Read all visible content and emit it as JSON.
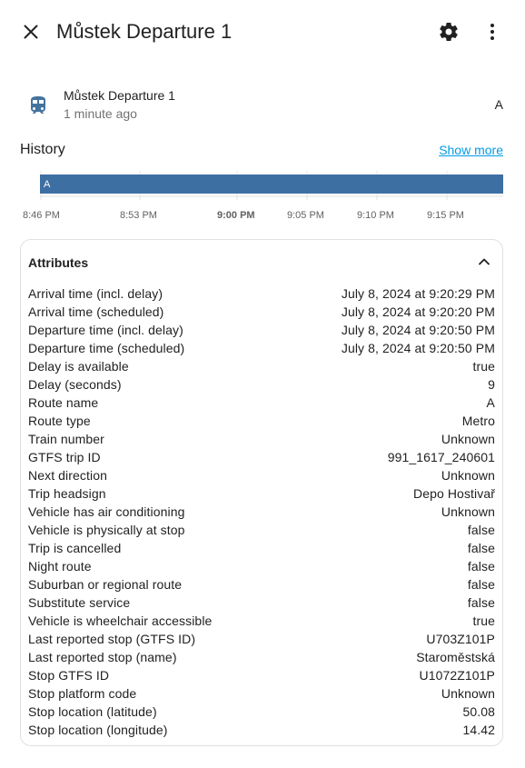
{
  "dialog": {
    "title": "Můstek Departure 1"
  },
  "entity": {
    "name": "Můstek Departure 1",
    "last_changed": "1 minute ago",
    "state": "A",
    "icon": "train-icon"
  },
  "history": {
    "title": "History",
    "show_more": "Show more",
    "bar_label": "A",
    "bar_color": "#3e6fa3",
    "ticks": [
      "8:46 PM",
      "8:53 PM",
      "9:00 PM",
      "9:05 PM",
      "9:10 PM",
      "9:15 PM"
    ]
  },
  "attributes": {
    "title": "Attributes",
    "rows": [
      {
        "key": "Arrival time (incl. delay)",
        "value": "July 8, 2024 at 9:20:29 PM"
      },
      {
        "key": "Arrival time (scheduled)",
        "value": "July 8, 2024 at 9:20:20 PM"
      },
      {
        "key": "Departure time (incl. delay)",
        "value": "July 8, 2024 at 9:20:50 PM"
      },
      {
        "key": "Departure time (scheduled)",
        "value": "July 8, 2024 at 9:20:50 PM"
      },
      {
        "key": "Delay is available",
        "value": "true"
      },
      {
        "key": "Delay (seconds)",
        "value": "9"
      },
      {
        "key": "Route name",
        "value": "A"
      },
      {
        "key": "Route type",
        "value": "Metro"
      },
      {
        "key": "Train number",
        "value": "Unknown"
      },
      {
        "key": "GTFS trip ID",
        "value": "991_1617_240601"
      },
      {
        "key": "Next direction",
        "value": "Unknown"
      },
      {
        "key": "Trip headsign",
        "value": "Depo Hostivař"
      },
      {
        "key": "Vehicle has air conditioning",
        "value": "Unknown"
      },
      {
        "key": "Vehicle is physically at stop",
        "value": "false"
      },
      {
        "key": "Trip is cancelled",
        "value": "false"
      },
      {
        "key": "Night route",
        "value": "false"
      },
      {
        "key": "Suburban or regional route",
        "value": "false"
      },
      {
        "key": "Substitute service",
        "value": "false"
      },
      {
        "key": "Vehicle is wheelchair accessible",
        "value": "true"
      },
      {
        "key": "Last reported stop (GTFS ID)",
        "value": "U703Z101P"
      },
      {
        "key": "Last reported stop (name)",
        "value": "Staroměstská"
      },
      {
        "key": "Stop GTFS ID",
        "value": "U1072Z101P"
      },
      {
        "key": "Stop platform code",
        "value": "Unknown"
      },
      {
        "key": "Stop location (latitude)",
        "value": "50.08"
      },
      {
        "key": "Stop location (longitude)",
        "value": "14.42"
      }
    ]
  }
}
